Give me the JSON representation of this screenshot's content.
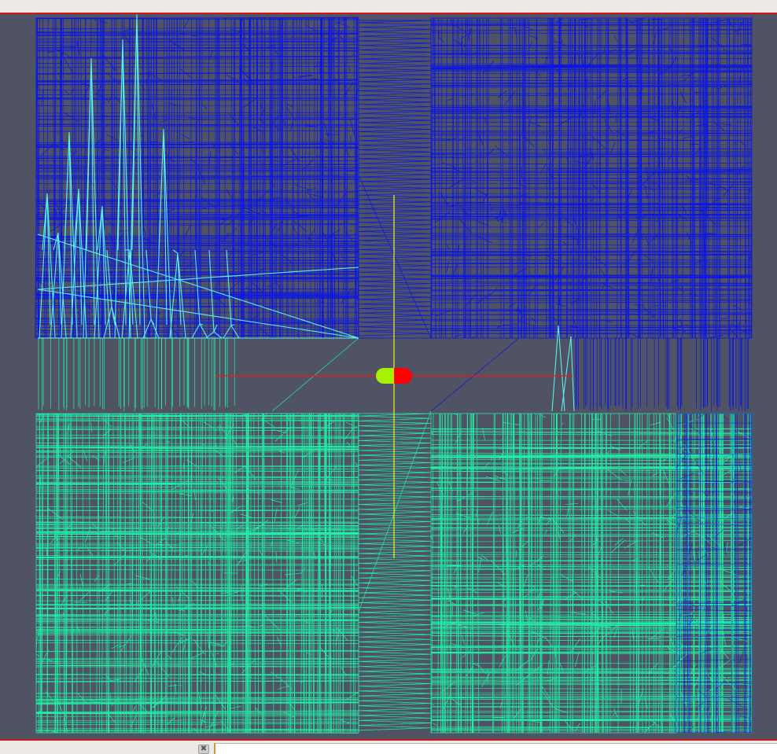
{
  "window": {
    "title": ""
  },
  "viewport": {
    "background_color": "#4f5363",
    "frame_color": "#d01818",
    "meshes": [
      {
        "name": "upper",
        "color": "#0a14e6"
      },
      {
        "name": "lower",
        "color": "#20f0a8"
      },
      {
        "name": "spikes",
        "color": "#58f0ea"
      }
    ],
    "axis_colors": {
      "horizontal": "#ff1010",
      "vertical": "#f0f020"
    },
    "cursor_colors": {
      "left": "#a6f000",
      "right": "#ff0000"
    }
  },
  "statusbar": {
    "close_icon": "close-icon",
    "close_glyph": "✖",
    "command_value": ""
  }
}
